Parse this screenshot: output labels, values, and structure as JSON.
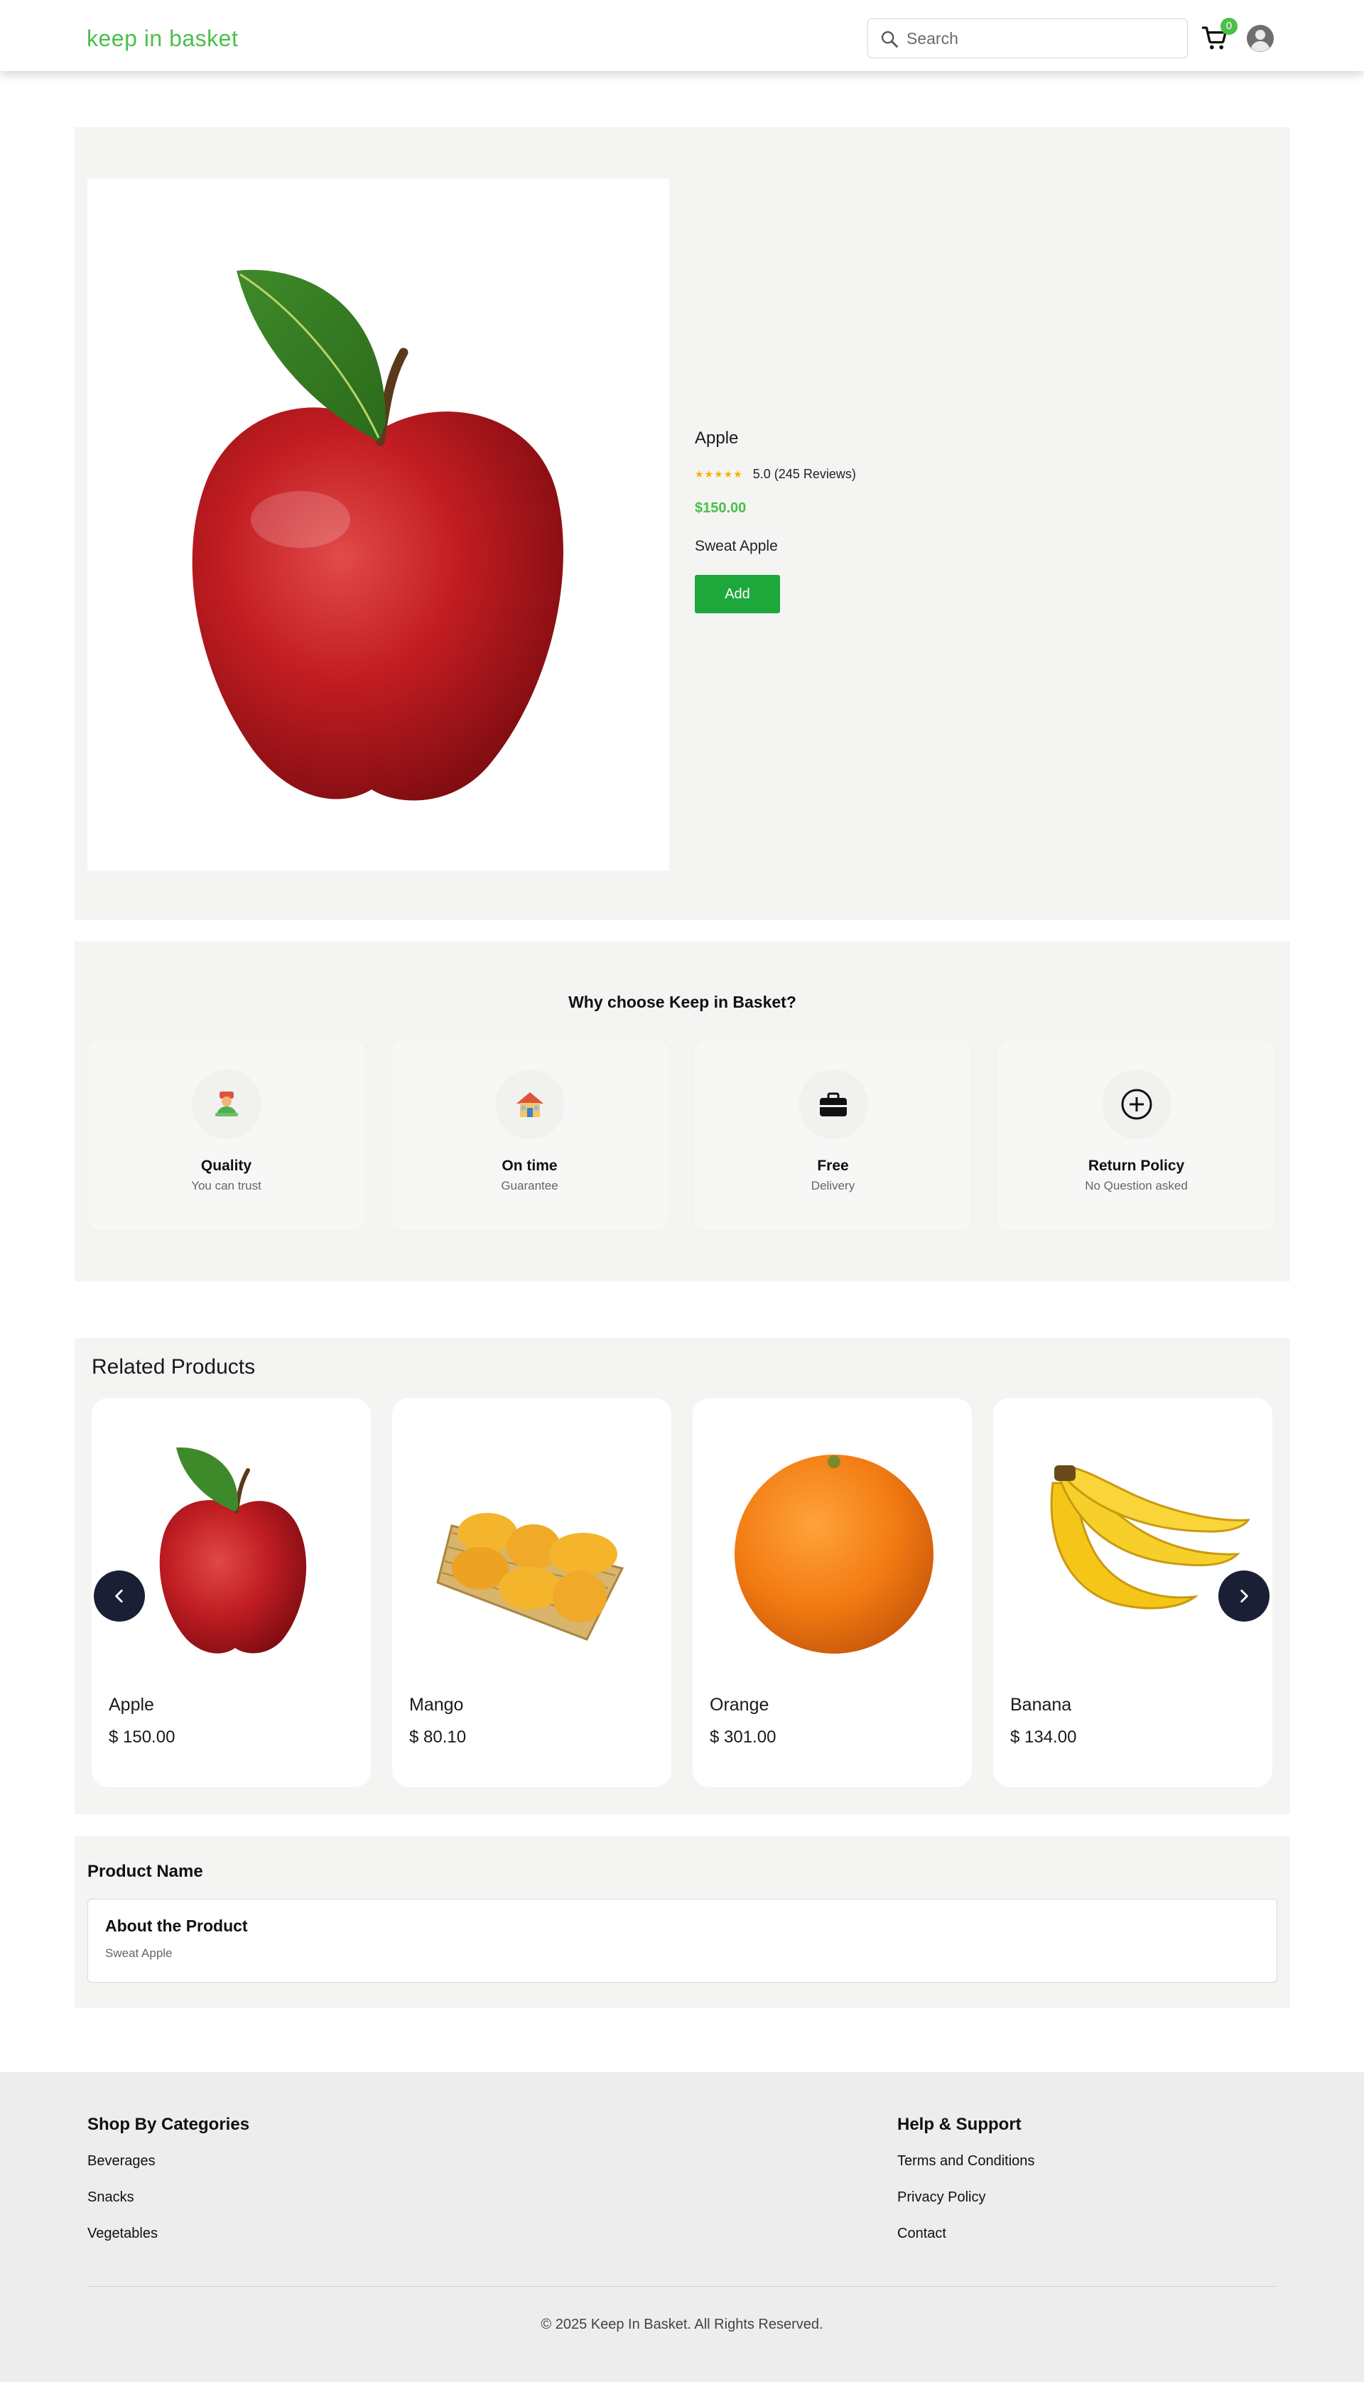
{
  "header": {
    "logo": "keep in basket",
    "search_placeholder": "Search",
    "cart_count": "0",
    "brand_color": "#4cbf4a"
  },
  "product": {
    "name": "Apple",
    "rating_stars": "★★★★★",
    "rating_text": "5.0 (245 Reviews)",
    "price": "$150.00",
    "description": "Sweat Apple",
    "add_label": "Add",
    "add_button_color": "#1ea83c",
    "image_icon": "apple-image"
  },
  "why": {
    "title": "Why choose Keep in Basket?",
    "cards": [
      {
        "icon": "quality-icon",
        "title": "Quality",
        "sub": "You can trust"
      },
      {
        "icon": "house-icon",
        "title": "On time",
        "sub": "Guarantee"
      },
      {
        "icon": "briefcase-icon",
        "title": "Free",
        "sub": "Delivery"
      },
      {
        "icon": "plus-circle-icon",
        "title": "Return Policy",
        "sub": "No Question asked"
      }
    ]
  },
  "related": {
    "title": "Related Products",
    "items": [
      {
        "name": "Apple",
        "price": "$ 150.00",
        "image": "apple-image"
      },
      {
        "name": "Mango",
        "price": "$ 80.10",
        "image": "mango-image"
      },
      {
        "name": "Orange",
        "price": "$ 301.00",
        "image": "orange-image"
      },
      {
        "name": "Banana",
        "price": "$ 134.00",
        "image": "banana-image"
      }
    ],
    "prev_icon": "chevron-left-icon",
    "next_icon": "chevron-right-icon"
  },
  "about": {
    "section_title": "Product Name",
    "box_title": "About the Product",
    "box_text": "Sweat Apple"
  },
  "footer": {
    "categories_title": "Shop By Categories",
    "categories": [
      "Beverages",
      "Snacks",
      "Vegetables"
    ],
    "help_title": "Help & Support",
    "help_links": [
      "Terms and Conditions",
      "Privacy Policy",
      "Contact"
    ],
    "copyright": "© 2025 Keep In Basket. All Rights Reserved."
  }
}
